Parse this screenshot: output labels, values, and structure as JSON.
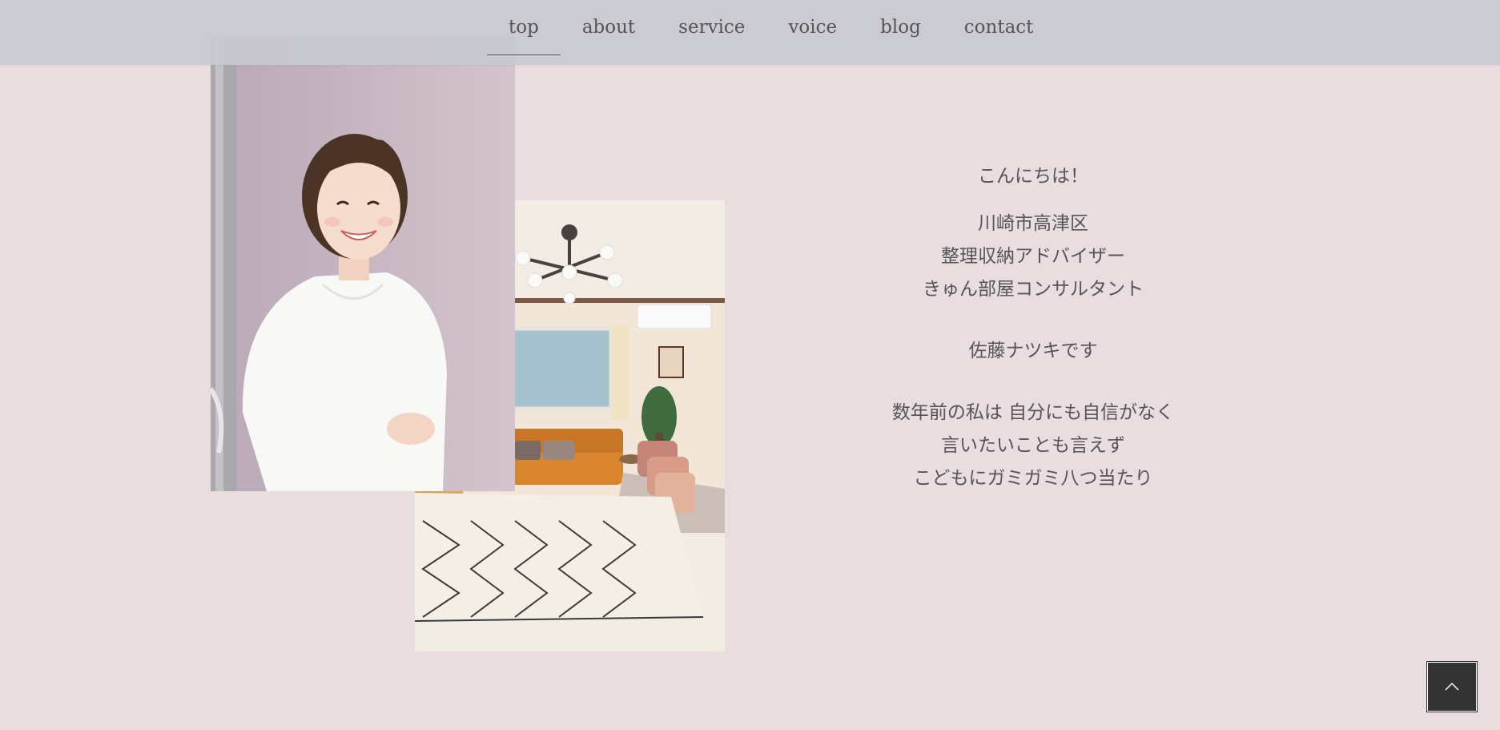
{
  "nav": {
    "items": [
      {
        "label": "top",
        "active": true
      },
      {
        "label": "about",
        "active": false
      },
      {
        "label": "service",
        "active": false
      },
      {
        "label": "voice",
        "active": false
      },
      {
        "label": "blog",
        "active": false
      },
      {
        "label": "contact",
        "active": false
      }
    ]
  },
  "intro": {
    "greeting": "こんにちは！",
    "roles": [
      "川崎市高津区",
      "整理収納アドバイザー",
      "きゅん部屋コンサルタント"
    ],
    "name": "佐藤ナツキです",
    "story": [
      "数年前の私は 自分にも自信がなく",
      "言いたいことも言えず",
      "こどもにガミガミ八つ当たり"
    ]
  },
  "icons": {
    "back_to_top": "chevron-up-icon"
  },
  "colors": {
    "page_background": "#e9dddf",
    "header_background": "#c8c9d2",
    "text": "#555555",
    "back_to_top_background": "#333333"
  }
}
